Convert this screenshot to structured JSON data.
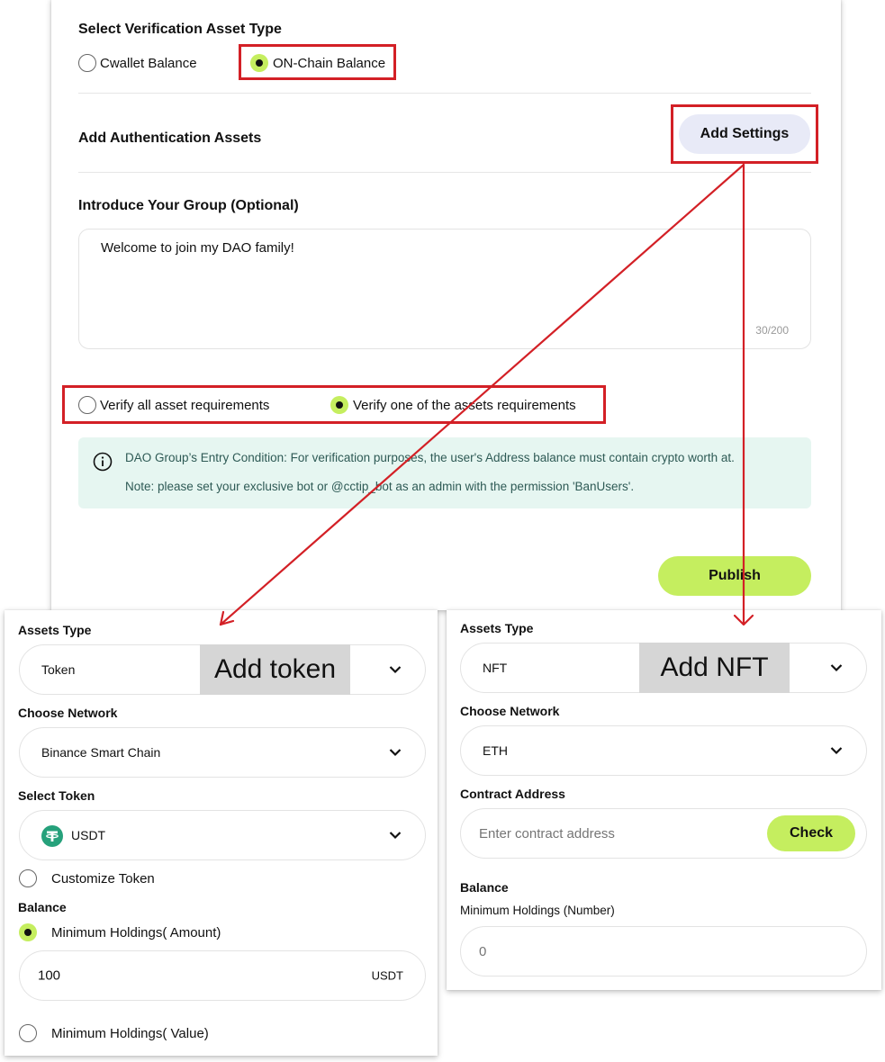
{
  "top": {
    "asset_type_heading": "Select Verification Asset Type",
    "asset_type_options": [
      "Cwallet Balance",
      "ON-Chain Balance"
    ],
    "auth_assets_label": "Add Authentication Assets",
    "add_settings_label": "Add Settings",
    "intro_label": "Introduce Your Group (Optional)",
    "intro_text": "Welcome to join my DAO family!",
    "intro_count": "30/200",
    "verify_options": [
      "Verify all asset requirements",
      "Verify one of the assets requirements"
    ],
    "notice_line1": "DAO Group’s Entry Condition: For verification purposes, the user's Address balance must contain crypto worth at.",
    "notice_line2": "Note: please set your exclusive bot or @cctip_bot as an admin with the permission 'BanUsers'.",
    "publish_label": "Publish"
  },
  "token_panel": {
    "assets_type_label": "Assets Type",
    "assets_type_value": "Token",
    "overlay": "Add token",
    "network_label": "Choose Network",
    "network_value": "Binance Smart Chain",
    "select_token_label": "Select Token",
    "token_value": "USDT",
    "customize_label": "Customize Token",
    "balance_label": "Balance",
    "min_amount_label": "Minimum Holdings( Amount)",
    "amount_value": "100",
    "amount_unit": "USDT",
    "min_value_label": "Minimum Holdings( Value)"
  },
  "nft_panel": {
    "assets_type_label": "Assets Type",
    "assets_type_value": "NFT",
    "overlay": "Add NFT",
    "network_label": "Choose Network",
    "network_value": "ETH",
    "contract_label": "Contract Address",
    "contract_placeholder": "Enter contract address",
    "check_label": "Check",
    "balance_label": "Balance",
    "min_holdings_label": "Minimum Holdings (Number)",
    "min_holdings_placeholder": "0"
  },
  "colors": {
    "accent_green": "#c5ee5f",
    "settings_button_bg": "#e8eaf7",
    "notice_bg": "#e6f6f1",
    "notice_text": "#2e5a55",
    "annotation_red": "#d32026",
    "token_icon": "#26a17b"
  },
  "icons": [
    "info-icon",
    "chevron-down-icon",
    "usdt-token-icon"
  ]
}
